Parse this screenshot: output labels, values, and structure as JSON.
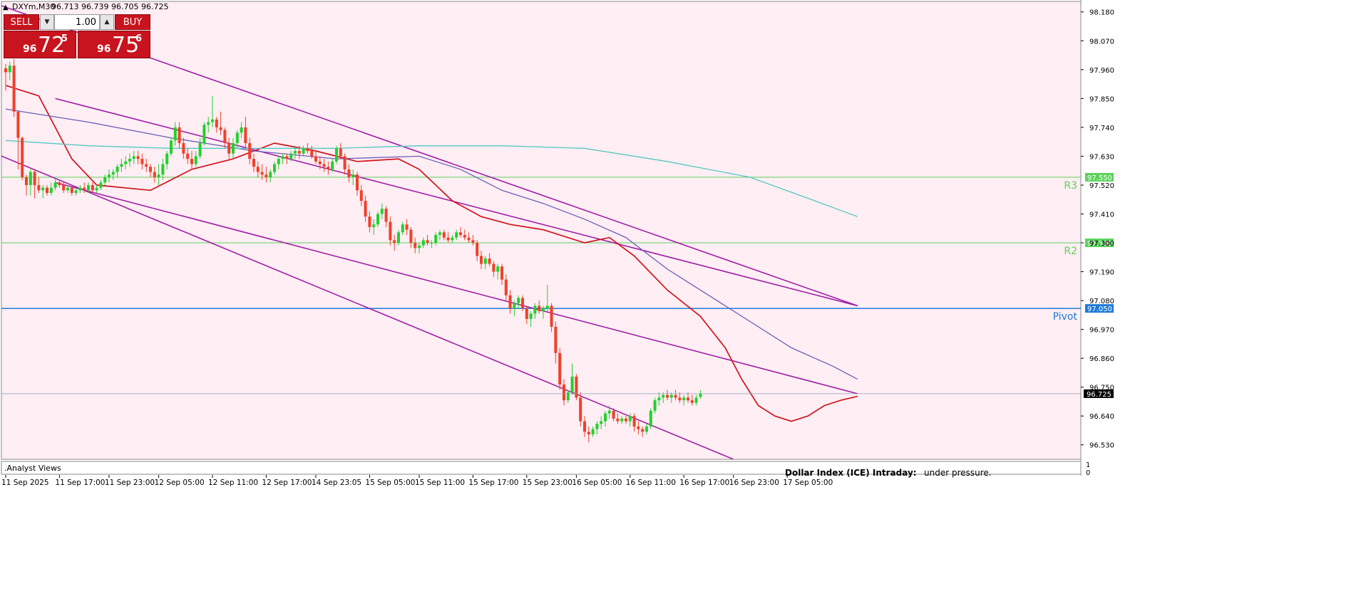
{
  "header": {
    "symbol": "DXYm,M30",
    "ohlc": "96.713 96.739 96.705 96.725",
    "arrow": "▲"
  },
  "trade_panel": {
    "sell_label": "SELL",
    "buy_label": "BUY",
    "lot": "1.00",
    "sell_price": {
      "small": "96",
      "big": "72",
      "sup": "5"
    },
    "buy_price": {
      "small": "96",
      "big": "75",
      "sup": "6"
    }
  },
  "indicator_panel": {
    "label": ".Analyst Views",
    "scale_top": "1",
    "scale_bottom": "0",
    "caption_bold": "Dollar Index (ICE) Intraday:",
    "caption_text": "under pressure."
  },
  "levels": [
    {
      "name": "R3",
      "value": 97.55,
      "price_label": "97.550",
      "color": "#5ad25a"
    },
    {
      "name": "R2",
      "value": 97.3,
      "price_label": "97.300",
      "color": "#5ad25a"
    },
    {
      "name": "Pivot",
      "value": 97.05,
      "price_label": "97.050",
      "color": "#1f7ad6"
    }
  ],
  "current_price": {
    "value": 96.725,
    "label": "96.725"
  },
  "colors": {
    "background": "#ffeef4",
    "bull_candle": "#22d02e",
    "bear_candle": "#f0402a",
    "ma_fast": "#d0141c",
    "ma_mid": "#6a60b8",
    "ma_slow": "#55c8c2",
    "channel": "#a01fa8"
  },
  "chart_data": {
    "type": "candlestick",
    "symbol": "DXYm",
    "timeframe": "M30",
    "ylim": [
      96.475,
      98.22
    ],
    "y_ticks": [
      "98.180",
      "98.070",
      "97.960",
      "97.850",
      "97.740",
      "97.630",
      "97.520",
      "97.410",
      "97.300",
      "97.190",
      "97.080",
      "96.970",
      "96.860",
      "96.750",
      "96.640",
      "96.530"
    ],
    "x_ticks": [
      {
        "label": "11 Sep 2025",
        "index": 0
      },
      {
        "label": "11 Sep 17:00",
        "index": 13
      },
      {
        "label": "11 Sep 23:00",
        "index": 25
      },
      {
        "label": "12 Sep 05:00",
        "index": 37
      },
      {
        "label": "12 Sep 11:00",
        "index": 50
      },
      {
        "label": "12 Sep 17:00",
        "index": 63
      },
      {
        "label": "14 Sep 23:05",
        "index": 75
      },
      {
        "label": "15 Sep 05:00",
        "index": 88
      },
      {
        "label": "15 Sep 11:00",
        "index": 100
      },
      {
        "label": "15 Sep 17:00",
        "index": 113
      },
      {
        "label": "15 Sep 23:00",
        "index": 126
      },
      {
        "label": "16 Sep 05:00",
        "index": 138
      },
      {
        "label": "16 Sep 11:00",
        "index": 151
      },
      {
        "label": "16 Sep 17:00",
        "index": 164
      },
      {
        "label": "16 Sep 23:00",
        "index": 176
      },
      {
        "label": "17 Sep 05:00",
        "index": 189
      }
    ],
    "candles": [
      [
        97.965,
        97.982,
        97.88,
        97.95
      ],
      [
        97.95,
        97.99,
        97.92,
        97.975
      ],
      [
        97.975,
        98.0,
        97.78,
        97.8
      ],
      [
        97.8,
        97.72,
        97.58,
        97.7
      ],
      [
        97.7,
        97.705,
        97.54,
        97.55
      ],
      [
        97.55,
        97.56,
        97.48,
        97.52
      ],
      [
        97.52,
        97.58,
        97.48,
        97.57
      ],
      [
        97.57,
        97.58,
        97.47,
        97.52
      ],
      [
        97.52,
        97.55,
        97.49,
        97.5
      ],
      [
        97.5,
        97.52,
        97.47,
        97.51
      ],
      [
        97.51,
        97.52,
        97.48,
        97.49
      ],
      [
        97.49,
        97.53,
        97.48,
        97.51
      ],
      [
        97.51,
        97.55,
        97.5,
        97.53
      ],
      [
        97.53,
        97.54,
        97.51,
        97.52
      ],
      [
        97.52,
        97.53,
        97.49,
        97.5
      ],
      [
        97.5,
        97.52,
        97.49,
        97.51
      ],
      [
        97.51,
        97.52,
        97.48,
        97.49
      ],
      [
        97.49,
        97.51,
        97.48,
        97.5
      ],
      [
        97.5,
        97.52,
        97.49,
        97.51
      ],
      [
        97.51,
        97.53,
        97.49,
        97.5
      ],
      [
        97.5,
        97.53,
        97.49,
        97.52
      ],
      [
        97.52,
        97.53,
        97.49,
        97.5
      ],
      [
        97.5,
        97.52,
        97.49,
        97.51
      ],
      [
        97.51,
        97.54,
        97.5,
        97.53
      ],
      [
        97.53,
        97.56,
        97.52,
        97.55
      ],
      [
        97.55,
        97.58,
        97.53,
        97.56
      ],
      [
        97.56,
        97.58,
        97.54,
        97.57
      ],
      [
        97.57,
        97.6,
        97.55,
        97.59
      ],
      [
        97.59,
        97.62,
        97.57,
        97.6
      ],
      [
        97.6,
        97.63,
        97.58,
        97.61
      ],
      [
        97.61,
        97.64,
        97.59,
        97.62
      ],
      [
        97.62,
        97.65,
        97.6,
        97.63
      ],
      [
        97.63,
        97.65,
        97.6,
        97.62
      ],
      [
        97.62,
        97.64,
        97.58,
        97.6
      ],
      [
        97.6,
        97.62,
        97.57,
        97.59
      ],
      [
        97.59,
        97.6,
        97.55,
        97.57
      ],
      [
        97.57,
        97.59,
        97.53,
        97.55
      ],
      [
        97.55,
        97.6,
        97.52,
        97.56
      ],
      [
        97.56,
        97.62,
        97.54,
        97.6
      ],
      [
        97.6,
        97.65,
        97.58,
        97.64
      ],
      [
        97.64,
        97.7,
        97.63,
        97.69
      ],
      [
        97.69,
        97.76,
        97.67,
        97.74
      ],
      [
        97.74,
        97.76,
        97.66,
        97.68
      ],
      [
        97.68,
        97.7,
        97.62,
        97.64
      ],
      [
        97.64,
        97.66,
        97.6,
        97.62
      ],
      [
        97.62,
        97.65,
        97.58,
        97.6
      ],
      [
        97.6,
        97.65,
        97.59,
        97.63
      ],
      [
        97.63,
        97.7,
        97.62,
        97.68
      ],
      [
        97.68,
        97.76,
        97.67,
        97.75
      ],
      [
        97.75,
        97.78,
        97.72,
        97.76
      ],
      [
        97.76,
        97.86,
        97.74,
        97.77
      ],
      [
        97.77,
        97.78,
        97.72,
        97.74
      ],
      [
        97.74,
        97.8,
        97.71,
        97.73
      ],
      [
        97.73,
        97.74,
        97.66,
        97.68
      ],
      [
        97.68,
        97.7,
        97.62,
        97.64
      ],
      [
        97.64,
        97.7,
        97.62,
        97.68
      ],
      [
        97.68,
        97.73,
        97.66,
        97.72
      ],
      [
        97.72,
        97.76,
        97.7,
        97.74
      ],
      [
        97.74,
        97.78,
        97.66,
        97.68
      ],
      [
        97.68,
        97.7,
        97.6,
        97.62
      ],
      [
        97.62,
        97.64,
        97.57,
        97.59
      ],
      [
        97.59,
        97.61,
        97.55,
        97.57
      ],
      [
        97.57,
        97.6,
        97.54,
        97.56
      ],
      [
        97.56,
        97.59,
        97.53,
        97.55
      ],
      [
        97.55,
        97.58,
        97.53,
        97.57
      ],
      [
        97.57,
        97.61,
        97.56,
        97.6
      ],
      [
        97.6,
        97.63,
        97.58,
        97.62
      ],
      [
        97.62,
        97.64,
        97.6,
        97.63
      ],
      [
        97.63,
        97.64,
        97.6,
        97.62
      ],
      [
        97.62,
        97.65,
        97.61,
        97.64
      ],
      [
        97.64,
        97.67,
        97.62,
        97.65
      ],
      [
        97.65,
        97.67,
        97.62,
        97.64
      ],
      [
        97.64,
        97.67,
        97.63,
        97.66
      ],
      [
        97.66,
        97.68,
        97.64,
        97.65
      ],
      [
        97.65,
        97.67,
        97.62,
        97.63
      ],
      [
        97.63,
        97.65,
        97.6,
        97.61
      ],
      [
        97.61,
        97.63,
        97.58,
        97.6
      ],
      [
        97.6,
        97.62,
        97.57,
        97.59
      ],
      [
        97.59,
        97.61,
        97.56,
        97.58
      ],
      [
        97.58,
        97.62,
        97.57,
        97.61
      ],
      [
        97.61,
        97.67,
        97.6,
        97.66
      ],
      [
        97.66,
        97.68,
        97.62,
        97.63
      ],
      [
        97.63,
        97.64,
        97.56,
        97.58
      ],
      [
        97.58,
        97.6,
        97.53,
        97.55
      ],
      [
        97.55,
        97.58,
        97.52,
        97.56
      ],
      [
        97.56,
        97.57,
        97.48,
        97.5
      ],
      [
        97.5,
        97.52,
        97.44,
        97.46
      ],
      [
        97.46,
        97.48,
        97.38,
        97.4
      ],
      [
        97.4,
        97.42,
        97.34,
        97.36
      ],
      [
        97.36,
        97.39,
        97.33,
        97.37
      ],
      [
        97.37,
        97.42,
        97.36,
        97.41
      ],
      [
        97.41,
        97.45,
        97.39,
        97.43
      ],
      [
        97.43,
        97.44,
        97.36,
        97.38
      ],
      [
        97.38,
        97.4,
        97.29,
        97.31
      ],
      [
        97.31,
        97.33,
        97.27,
        97.3
      ],
      [
        97.3,
        97.35,
        97.29,
        97.34
      ],
      [
        97.34,
        97.38,
        97.33,
        97.37
      ],
      [
        97.37,
        97.39,
        97.33,
        97.35
      ],
      [
        97.35,
        97.36,
        97.28,
        97.3
      ],
      [
        97.3,
        97.32,
        97.26,
        97.28
      ],
      [
        97.28,
        97.3,
        97.26,
        97.29
      ],
      [
        97.29,
        97.32,
        97.28,
        97.31
      ],
      [
        97.31,
        97.33,
        97.29,
        97.3
      ],
      [
        97.3,
        97.31,
        97.28,
        97.3
      ],
      [
        97.3,
        97.34,
        97.29,
        97.33
      ],
      [
        97.33,
        97.35,
        97.31,
        97.34
      ],
      [
        97.34,
        97.35,
        97.31,
        97.32
      ],
      [
        97.32,
        97.34,
        97.3,
        97.31
      ],
      [
        97.31,
        97.33,
        97.3,
        97.32
      ],
      [
        97.32,
        97.35,
        97.31,
        97.34
      ],
      [
        97.34,
        97.36,
        97.32,
        97.33
      ],
      [
        97.33,
        97.35,
        97.31,
        97.32
      ],
      [
        97.32,
        97.34,
        97.3,
        97.31
      ],
      [
        97.31,
        97.33,
        97.29,
        97.3
      ],
      [
        97.3,
        97.31,
        97.23,
        97.25
      ],
      [
        97.25,
        97.27,
        97.2,
        97.22
      ],
      [
        97.22,
        97.25,
        97.2,
        97.24
      ],
      [
        97.24,
        97.26,
        97.21,
        97.22
      ],
      [
        97.22,
        97.23,
        97.17,
        97.19
      ],
      [
        97.19,
        97.22,
        97.16,
        97.21
      ],
      [
        97.21,
        97.22,
        97.14,
        97.16
      ],
      [
        97.16,
        97.18,
        97.08,
        97.1
      ],
      [
        97.1,
        97.12,
        97.03,
        97.05
      ],
      [
        97.05,
        97.08,
        97.02,
        97.07
      ],
      [
        97.07,
        97.1,
        97.05,
        97.09
      ],
      [
        97.09,
        97.1,
        97.04,
        97.05
      ],
      [
        97.05,
        97.06,
        96.99,
        97.01
      ],
      [
        97.01,
        97.04,
        96.98,
        97.03
      ],
      [
        97.03,
        97.07,
        97.01,
        97.06
      ],
      [
        97.06,
        97.08,
        97.03,
        97.04
      ],
      [
        97.04,
        97.06,
        97.01,
        97.05
      ],
      [
        97.05,
        97.14,
        97.04,
        97.06
      ],
      [
        97.06,
        97.07,
        96.96,
        96.98
      ],
      [
        96.98,
        97.0,
        96.84,
        96.88
      ],
      [
        96.88,
        96.9,
        96.74,
        96.76
      ],
      [
        96.76,
        96.78,
        96.68,
        96.7
      ],
      [
        96.7,
        96.74,
        96.69,
        96.73
      ],
      [
        96.73,
        96.84,
        96.72,
        96.79
      ],
      [
        96.79,
        96.8,
        96.7,
        96.71
      ],
      [
        96.71,
        96.73,
        96.6,
        96.62
      ],
      [
        96.62,
        96.64,
        96.56,
        96.58
      ],
      [
        96.58,
        96.6,
        96.54,
        96.57
      ],
      [
        96.57,
        96.6,
        96.56,
        96.59
      ],
      [
        96.59,
        96.62,
        96.57,
        96.61
      ],
      [
        96.61,
        96.64,
        96.59,
        96.62
      ],
      [
        96.62,
        96.66,
        96.6,
        96.65
      ],
      [
        96.65,
        96.68,
        96.63,
        96.66
      ],
      [
        96.66,
        96.67,
        96.62,
        96.63
      ],
      [
        96.63,
        96.65,
        96.61,
        96.62
      ],
      [
        96.62,
        96.64,
        96.61,
        96.63
      ],
      [
        96.63,
        96.64,
        96.61,
        96.62
      ],
      [
        96.62,
        96.65,
        96.6,
        96.64
      ],
      [
        96.64,
        96.65,
        96.58,
        96.6
      ],
      [
        96.6,
        96.62,
        96.57,
        96.59
      ],
      [
        96.59,
        96.6,
        96.56,
        96.58
      ],
      [
        96.58,
        96.61,
        96.57,
        96.6
      ],
      [
        96.6,
        96.67,
        96.59,
        96.66
      ],
      [
        96.66,
        96.71,
        96.65,
        96.7
      ],
      [
        96.7,
        96.73,
        96.68,
        96.71
      ],
      [
        96.71,
        96.73,
        96.69,
        96.72
      ],
      [
        96.72,
        96.74,
        96.7,
        96.71
      ],
      [
        96.71,
        96.73,
        96.69,
        96.72
      ],
      [
        96.72,
        96.74,
        96.7,
        96.71
      ],
      [
        96.71,
        96.73,
        96.69,
        96.7
      ],
      [
        96.7,
        96.72,
        96.68,
        96.71
      ],
      [
        96.71,
        96.73,
        96.69,
        96.7
      ],
      [
        96.7,
        96.72,
        96.68,
        96.69
      ],
      [
        96.69,
        96.72,
        96.68,
        96.71
      ],
      [
        96.713,
        96.739,
        96.705,
        96.725
      ]
    ],
    "moving_averages": [
      {
        "color": "#d0141c",
        "points": [
          [
            0,
            97.9
          ],
          [
            8,
            97.86
          ],
          [
            16,
            97.62
          ],
          [
            22,
            97.52
          ],
          [
            35,
            97.5
          ],
          [
            45,
            97.58
          ],
          [
            55,
            97.62
          ],
          [
            65,
            97.68
          ],
          [
            75,
            97.65
          ],
          [
            85,
            97.61
          ],
          [
            95,
            97.62
          ],
          [
            100,
            97.58
          ],
          [
            108,
            97.46
          ],
          [
            115,
            97.4
          ],
          [
            122,
            97.37
          ],
          [
            130,
            97.35
          ],
          [
            140,
            97.3
          ],
          [
            146,
            97.32
          ],
          [
            152,
            97.25
          ],
          [
            160,
            97.12
          ],
          [
            168,
            97.02
          ],
          [
            174,
            96.9
          ],
          [
            178,
            96.78
          ],
          [
            182,
            96.68
          ],
          [
            186,
            96.64
          ],
          [
            190,
            96.62
          ],
          [
            194,
            96.64
          ],
          [
            198,
            96.68
          ],
          [
            202,
            96.7
          ],
          [
            206,
            96.715
          ]
        ]
      },
      {
        "color": "#6a60b8",
        "points": [
          [
            0,
            97.81
          ],
          [
            20,
            97.76
          ],
          [
            40,
            97.7
          ],
          [
            60,
            97.65
          ],
          [
            80,
            97.62
          ],
          [
            100,
            97.63
          ],
          [
            110,
            97.58
          ],
          [
            120,
            97.5
          ],
          [
            130,
            97.45
          ],
          [
            140,
            97.39
          ],
          [
            150,
            97.32
          ],
          [
            160,
            97.2
          ],
          [
            170,
            97.1
          ],
          [
            180,
            97.0
          ],
          [
            190,
            96.9
          ],
          [
            200,
            96.83
          ],
          [
            206,
            96.78
          ]
        ]
      },
      {
        "color": "#55c8c2",
        "points": [
          [
            0,
            97.69
          ],
          [
            20,
            97.67
          ],
          [
            40,
            97.66
          ],
          [
            60,
            97.66
          ],
          [
            80,
            97.66
          ],
          [
            100,
            97.67
          ],
          [
            120,
            97.67
          ],
          [
            140,
            97.66
          ],
          [
            160,
            97.61
          ],
          [
            180,
            97.55
          ],
          [
            194,
            97.47
          ],
          [
            206,
            97.4
          ]
        ]
      }
    ],
    "channel_lines": [
      {
        "from": [
          12,
          97.85
        ],
        "to": [
          206,
          97.06
        ]
      },
      {
        "from": [
          12,
          97.53
        ],
        "to": [
          206,
          96.725
        ]
      },
      {
        "from": [
          -4,
          98.22
        ],
        "to": [
          206,
          97.06
        ]
      },
      {
        "from": [
          -4,
          97.65
        ],
        "to": [
          176,
          96.475
        ]
      }
    ]
  }
}
